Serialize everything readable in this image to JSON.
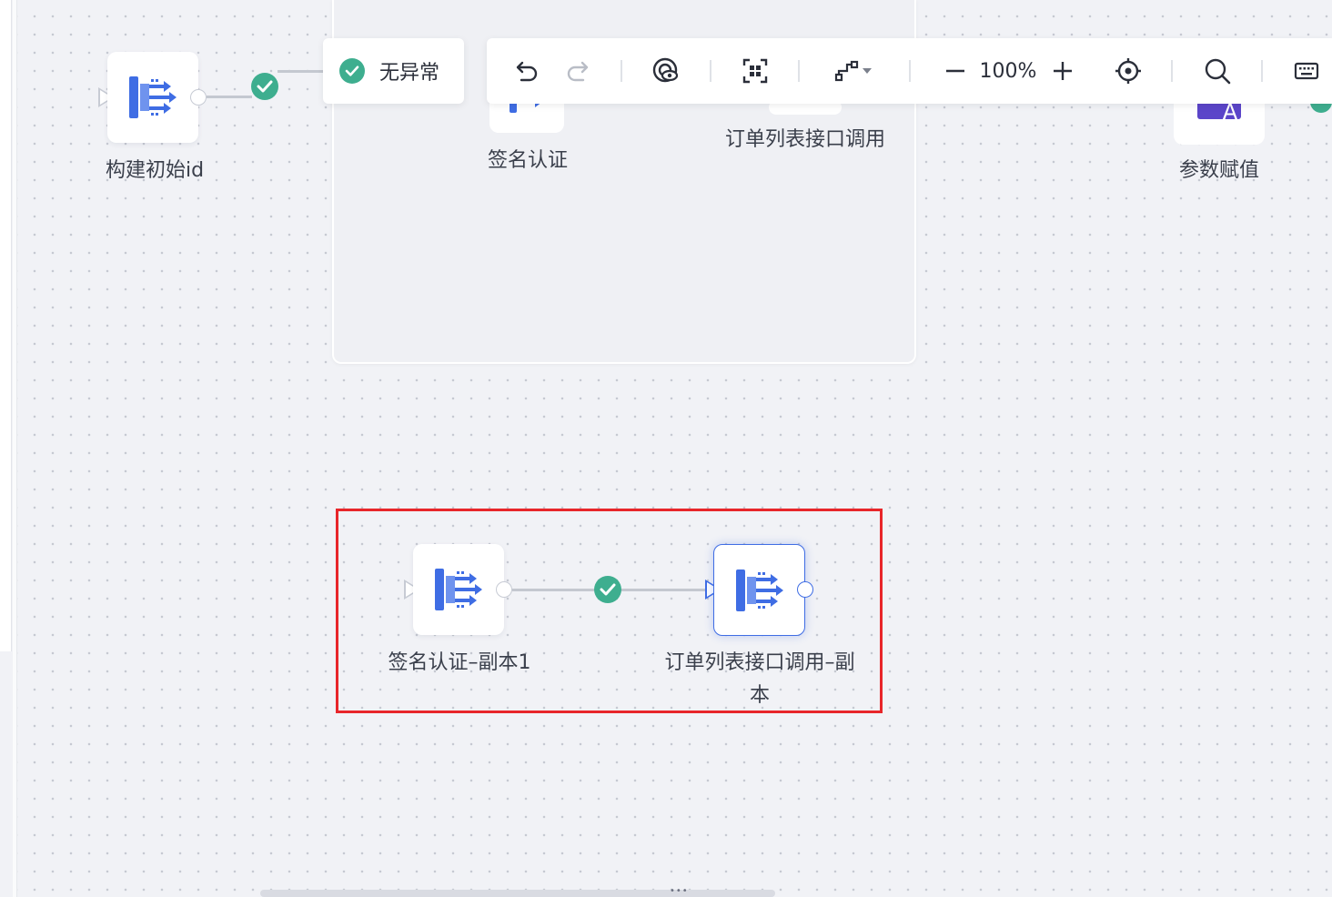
{
  "status": {
    "label": "无异常"
  },
  "toolbar": {
    "zoom_value": "100%",
    "items": [
      "undo-icon",
      "redo-icon",
      "preview-icon",
      "fit-view-icon",
      "connector-style-icon",
      "zoom-out-icon",
      "zoom-in-icon",
      "locate-icon",
      "search-icon",
      "keyboard-icon"
    ]
  },
  "canvas": {
    "nodes": [
      {
        "label": "构建初始id"
      },
      {
        "label": "签名认证"
      },
      {
        "label": "订单列表接口调用"
      },
      {
        "label": "参数赋值"
      },
      {
        "label": "签名认证–副本1"
      },
      {
        "label": "订单列表接口调用–副",
        "label_line2": "本"
      }
    ]
  },
  "colors": {
    "accent": "#3f6de4",
    "success": "#3eae8f",
    "highlight": "#e8262a",
    "purple_node": "#5b45c9"
  }
}
